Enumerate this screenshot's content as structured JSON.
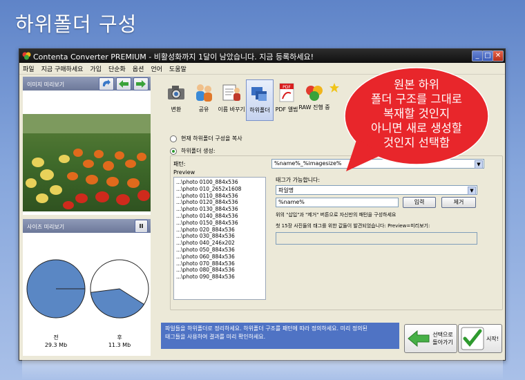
{
  "page": {
    "title": "하위폴더 구성"
  },
  "window": {
    "title": "Contenta Converter PREMIUM - 비활성화까지 1달이 남았습니다. 지금 등록하세요!",
    "controls": {
      "minimize": "_",
      "maximize": "□",
      "close": "✕"
    }
  },
  "menu": [
    "파일",
    "지금 구매하세요",
    "가입",
    "단순화",
    "옵션",
    "언어",
    "도움말"
  ],
  "left": {
    "image_preview_label": "이미지 미리보기",
    "size_preview_label": "사이즈 미리보기",
    "pause_glyph": "II",
    "before": {
      "label": "전",
      "size": "29.3 Mb",
      "fraction": 0.25
    },
    "after": {
      "label": "후",
      "size": "11.3 Mb",
      "fraction": 0.39
    }
  },
  "toolbar": [
    {
      "label": "변환",
      "icon": "camera-icon"
    },
    {
      "label": "공유",
      "icon": "people-icon"
    },
    {
      "label": "이름 바꾸기",
      "icon": "rename-icon"
    },
    {
      "label": "하위폴더",
      "icon": "folder-tree-icon",
      "active": true
    },
    {
      "label": "PDF 앨범",
      "icon": "pdf-icon"
    },
    {
      "label": "RAW 진행 중",
      "icon": "raw-icon"
    }
  ],
  "options": {
    "copy_structure": "현재 하위폴더 구성을 복사",
    "create_structure": "하위폴더 생성:"
  },
  "pattern": {
    "label": "패턴:",
    "value": "%name%_%imagesize%",
    "preview_label": "Preview",
    "preview_items": [
      "...\\photo 0100_884x536",
      "...\\photo 010_2652x1608",
      "...\\photo 0110_884x536",
      "...\\photo 0120_884x536",
      "...\\photo 0130_884x536",
      "...\\photo 0140_884x536",
      "...\\photo 0150_884x536",
      "...\\photo 020_884x536",
      "...\\photo 030_884x536",
      "...\\photo 040_246x202",
      "...\\photo 050_884x536",
      "...\\photo 060_884x536",
      "...\\photo 070_884x536",
      "...\\photo 080_884x536",
      "...\\photo 090_884x536"
    ]
  },
  "tags": {
    "available_label": "태그가 가능합니다:",
    "selected": "파일명",
    "input_value": "%name%",
    "insert_button": "입력",
    "remove_button": "제거",
    "hint": "위의 \"삽입\"과 \"제거\" 버튼으로 자신만의 패턴을 구성하세요",
    "found": "첫 15장 사진들의 태그를 위한 값들이 발견되었습니다: Preview=미리보기:"
  },
  "bottom": {
    "info_line1": "파일들을 하위폴더로 정리하세요. 하위폴더 구조를 패턴에 따라 정의하세요. 미리 정의된",
    "info_line2": "태그들을 사용하여 결과를 미리 확인하세요.",
    "back_line1": "선택으로",
    "back_line2": "돌아가기",
    "start": "시작!"
  },
  "callout": {
    "lines": [
      "원본 하위",
      "폴더 구조를 그대로",
      "복재할 것인지",
      "아니면 새로 생성할",
      "것인지 선택함"
    ],
    "color": "#e8262b"
  }
}
